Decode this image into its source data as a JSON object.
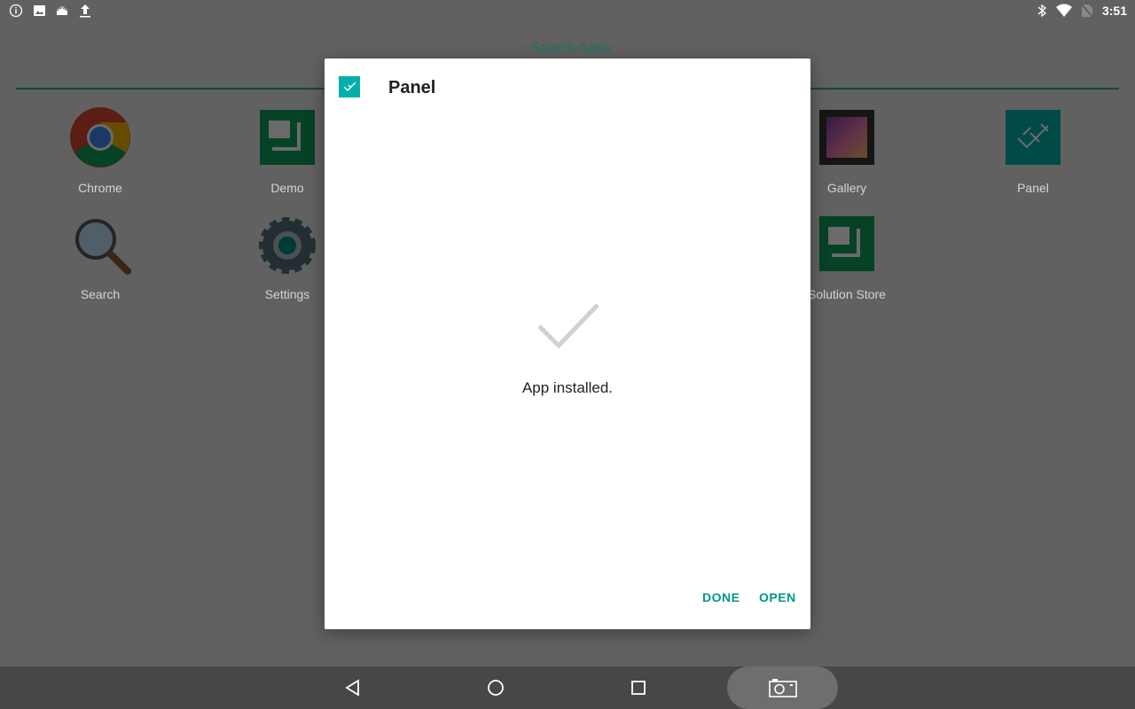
{
  "status_bar": {
    "left_icons": [
      "info-icon",
      "image-icon",
      "notification-icon",
      "upload-icon"
    ],
    "right_icons": [
      "bluetooth-icon",
      "wifi-icon",
      "no-sim-icon"
    ],
    "time": "3:51"
  },
  "launcher": {
    "search_placeholder": "Search Apps",
    "apps": [
      {
        "label": "Chrome",
        "icon": "chrome-icon"
      },
      {
        "label": "Demo",
        "icon": "demo-icon"
      },
      {
        "label": "Gallery",
        "icon": "gallery-icon"
      },
      {
        "label": "Panel",
        "icon": "panel-icon"
      },
      {
        "label": "Search",
        "icon": "magnifier-icon"
      },
      {
        "label": "Settings",
        "icon": "gear-icon"
      },
      {
        "label": "Solution Store",
        "icon": "solution-store-icon"
      }
    ]
  },
  "dialog": {
    "title": "Panel",
    "message": "App installed.",
    "done_label": "DONE",
    "open_label": "OPEN",
    "accent": "#009688"
  },
  "nav_bar": {
    "buttons": [
      "back-icon",
      "home-icon",
      "recents-icon",
      "screenshot-icon"
    ]
  }
}
